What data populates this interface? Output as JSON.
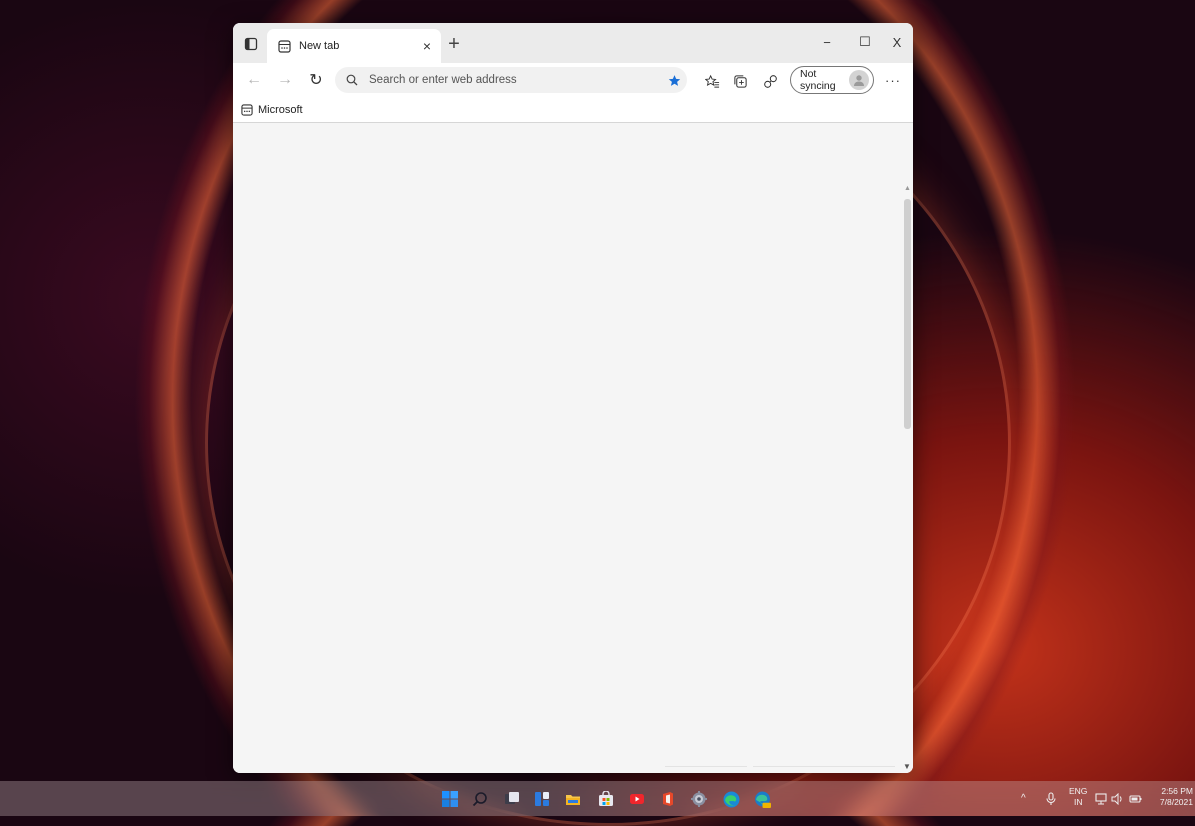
{
  "browser": {
    "tab": {
      "title": "New tab",
      "close": "×"
    },
    "new_tab": "+",
    "window_controls": {
      "minimize": "−",
      "maximize": "☐",
      "close": "X"
    },
    "toolbar": {
      "back": "←",
      "forward": "→",
      "refresh": "↻",
      "address_placeholder": "Search or enter web address",
      "sync_label": "Not syncing",
      "more": "···"
    },
    "favorites_bar": [
      {
        "label": "Microsoft"
      }
    ]
  },
  "taskbar": {
    "apps": [
      "start-icon",
      "search-icon",
      "task-view-icon",
      "widgets-icon",
      "file-explorer-icon",
      "store-icon",
      "youtube-icon",
      "office-icon",
      "settings-icon",
      "edge-icon",
      "edge-canary-icon"
    ],
    "tray": {
      "chevron": "^",
      "language_top": "ENG",
      "language_bottom": "IN",
      "time": "2:56 PM",
      "date": "7/8/2021"
    }
  },
  "colors": {
    "accent_star": "#1a6fd6",
    "browser_bg": "#f5f5f5"
  }
}
